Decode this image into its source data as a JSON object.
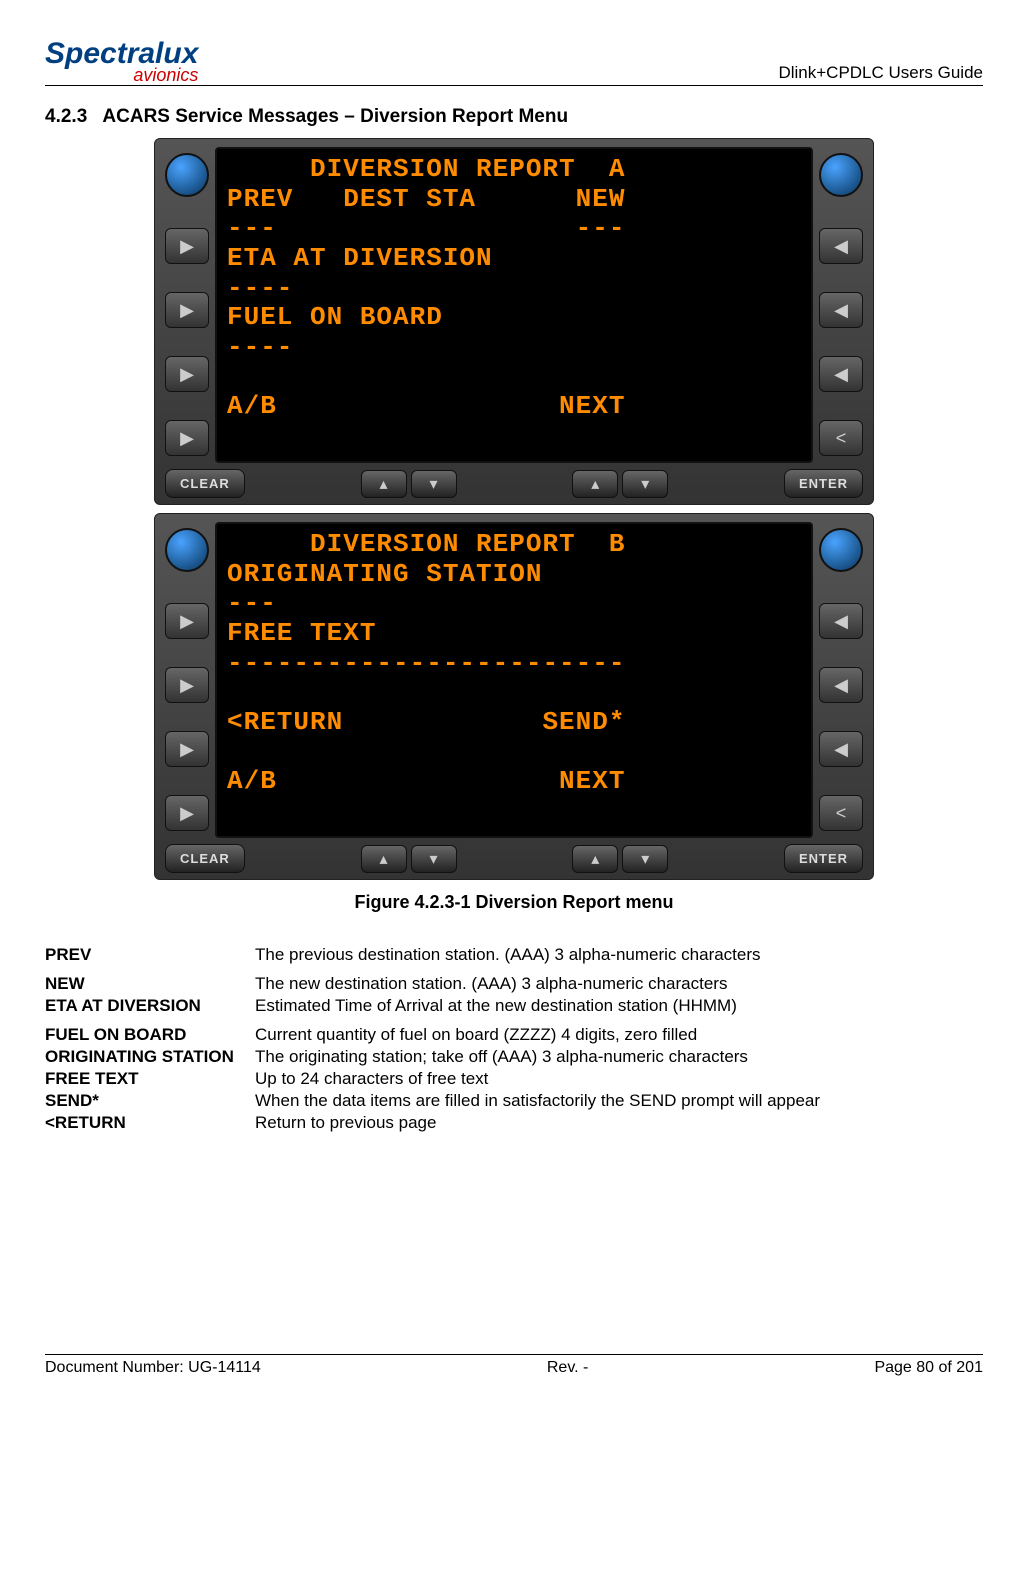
{
  "header": {
    "logo_top": "Spectralux",
    "logo_sub": "avionics",
    "guide": "Dlink+CPDLC Users Guide"
  },
  "section": {
    "number": "4.2.3",
    "title": "ACARS Service Messages – Diversion Report Menu"
  },
  "screenA": {
    "line1": "     DIVERSION REPORT  A",
    "line2": "PREV   DEST STA      NEW",
    "line3": "---                  ---",
    "line4": "ETA AT DIVERSION",
    "line5": "----",
    "line6": "FUEL ON BOARD",
    "line7": "----",
    "line8": "",
    "line9": "A/B                 NEXT"
  },
  "screenB": {
    "line1": "     DIVERSION REPORT  B",
    "line2": "ORIGINATING STATION",
    "line3": "---",
    "line4": "FREE TEXT",
    "line5": "------------------------",
    "line6": "",
    "line7": "<RETURN            SEND*",
    "line8": "",
    "line9": "A/B                 NEXT"
  },
  "buttons": {
    "clear": "CLEAR",
    "enter": "ENTER"
  },
  "caption": "Figure 4.2.3-1 Diversion Report menu",
  "fields": [
    {
      "term": "PREV",
      "desc": "The previous destination station. (AAA) 3 alpha-numeric characters"
    },
    {
      "term": "NEW",
      "desc": "The new destination station. (AAA) 3 alpha-numeric characters"
    },
    {
      "term": "ETA AT DIVERSION",
      "desc": "Estimated Time of Arrival at the new destination station (HHMM)"
    },
    {
      "term": "FUEL ON BOARD",
      "desc": "Current quantity of fuel on board  (ZZZZ) 4 digits, zero filled"
    },
    {
      "term": "ORIGINATING STATION",
      "desc": "The originating station; take off (AAA) 3 alpha-numeric characters"
    },
    {
      "term": "FREE TEXT",
      "desc": "Up to 24 characters of free text"
    },
    {
      "term": "SEND*",
      "desc": "When the data items are filled in satisfactorily the SEND prompt will appear"
    },
    {
      "term": "<RETURN",
      "desc": "Return to previous page"
    }
  ],
  "footer": {
    "doc": "Document Number:  UG-14114",
    "rev": "Rev. -",
    "page": "Page 80 of 201"
  }
}
